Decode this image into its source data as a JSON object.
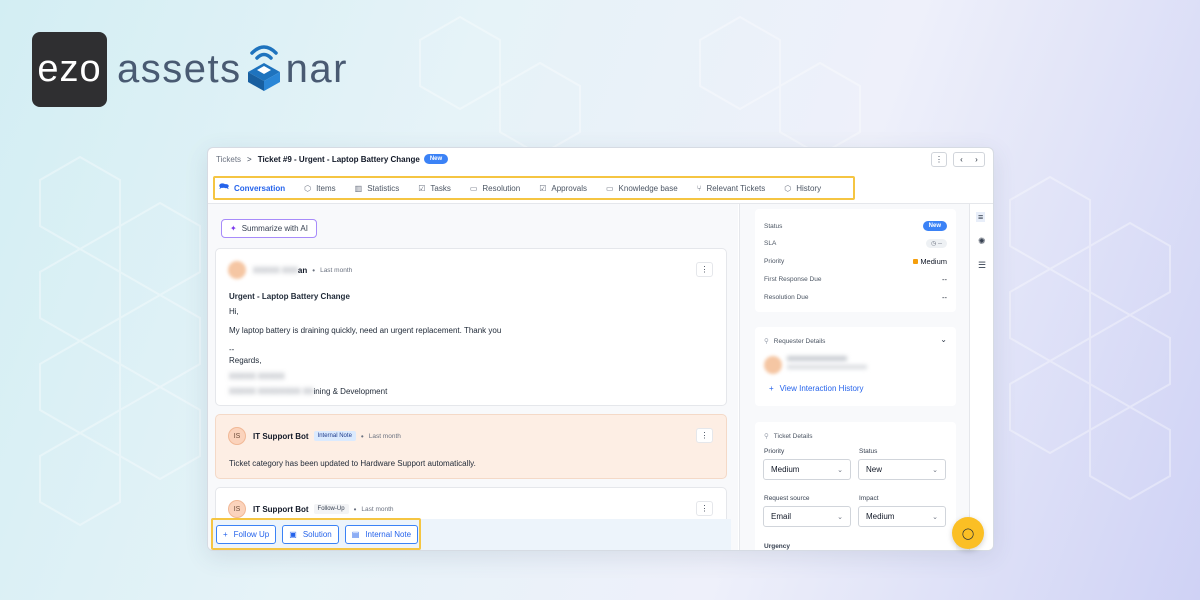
{
  "brand": {
    "ezo": "ezo",
    "name_left": "assets",
    "name_right": "nar"
  },
  "breadcrumb": {
    "root": "Tickets",
    "separator": ">",
    "title": "Ticket #9 - Urgent - Laptop Battery Change",
    "badge": "New"
  },
  "header_icons": {
    "more": "⋮",
    "prev": "‹",
    "next": "›"
  },
  "tabs": [
    {
      "label": "Conversation",
      "icon": "chat-icon",
      "glyph": "🗪"
    },
    {
      "label": "Items",
      "icon": "box-icon",
      "glyph": "⬡"
    },
    {
      "label": "Statistics",
      "icon": "bar-chart-icon",
      "glyph": "▥"
    },
    {
      "label": "Tasks",
      "icon": "checkbox-icon",
      "glyph": "☑"
    },
    {
      "label": "Resolution",
      "icon": "book-icon",
      "glyph": "▭"
    },
    {
      "label": "Approvals",
      "icon": "approval-icon",
      "glyph": "☑"
    },
    {
      "label": "Knowledge base",
      "icon": "book-open-icon",
      "glyph": "▭"
    },
    {
      "label": "Relevant Tickets",
      "icon": "link-tree-icon",
      "glyph": "⑂"
    },
    {
      "label": "History",
      "icon": "history-icon",
      "glyph": "⬡"
    }
  ],
  "summarize": {
    "label": "Summarize with AI",
    "glyph": "✦"
  },
  "email": {
    "sender_visible": "an",
    "time": "Last month",
    "subject": "Urgent - Laptop Battery Change",
    "greeting": "Hi,",
    "body": "My laptop battery is draining quickly, need an urgent replacement. Thank you",
    "sig_sep": "--",
    "regards": "Regards,",
    "dept_visible": "ining & Development"
  },
  "note": {
    "initials": "IS",
    "sender": "IT Support Bot",
    "tag": "Internal Note",
    "time": "Last month",
    "text": "Ticket category has been updated to Hardware Support automatically."
  },
  "followup": {
    "initials": "IS",
    "sender": "IT Support Bot",
    "tag": "Follow-Up",
    "time": "Last month"
  },
  "actions": [
    {
      "label": "Follow Up",
      "glyph": "+"
    },
    {
      "label": "Solution",
      "glyph": "▣"
    },
    {
      "label": "Internal Note",
      "glyph": "▤"
    }
  ],
  "status_panel": {
    "status_label": "Status",
    "status_value": "New",
    "sla_label": "SLA",
    "sla_value": "◷ --",
    "priority_label": "Priority",
    "priority_value": "Medium",
    "first_response_label": "First Response Due",
    "first_response_value": "--",
    "resolution_label": "Resolution Due",
    "resolution_value": "--"
  },
  "requester": {
    "title": "Requester Details",
    "link": "View Interaction History"
  },
  "ticket_details": {
    "title": "Ticket Details",
    "priority_label": "Priority",
    "priority_value": "Medium",
    "status_label": "Status",
    "status_value": "New",
    "source_label": "Request source",
    "source_value": "Email",
    "impact_label": "Impact",
    "impact_value": "Medium",
    "urgency_label": "Urgency"
  },
  "rail_icons": [
    "list-icon",
    "bug-icon",
    "checklist-icon"
  ],
  "colors": {
    "accent": "#2563eb",
    "highlight": "#f5c542",
    "note_bg": "#fdeee4",
    "fab": "#fbbf24"
  }
}
